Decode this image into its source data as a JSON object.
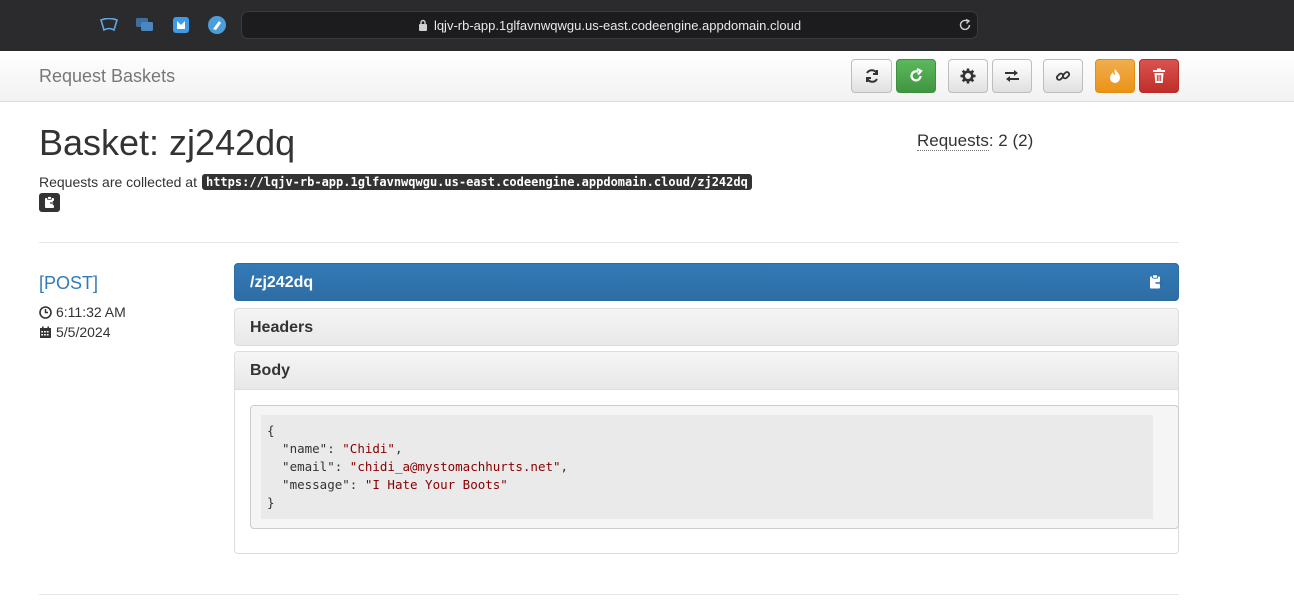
{
  "browser": {
    "url": "lqjv-rb-app.1glfavnwqwgu.us-east.codeengine.appdomain.cloud"
  },
  "navbar": {
    "brand": "Request Baskets"
  },
  "basket": {
    "title": "Basket: zj242dq",
    "collected_label": "Requests are collected at",
    "collected_url": "https://lqjv-rb-app.1glfavnwqwgu.us-east.codeengine.appdomain.cloud/zj242dq",
    "requests_label": "Requests",
    "requests_value": ": 2 (2)"
  },
  "request": {
    "method": "[POST]",
    "time": "6:11:32 AM",
    "date": "5/5/2024",
    "path": "/zj242dq",
    "headers_title": "Headers",
    "body_title": "Body",
    "body_lines": {
      "open": "{",
      "name_key": "  \"name\": ",
      "name_val": "\"Chidi\"",
      "email_key": "  \"email\": ",
      "email_val": "\"chidi_a@mystomachhurts.net\"",
      "message_key": "  \"message\": ",
      "message_val": "\"I Hate Your Boots\"",
      "comma": ",",
      "close": "}"
    }
  },
  "colors": {
    "primary": "#337ab7",
    "success": "#5cb85c",
    "warning": "#f0ad4e",
    "danger": "#d9534f"
  }
}
